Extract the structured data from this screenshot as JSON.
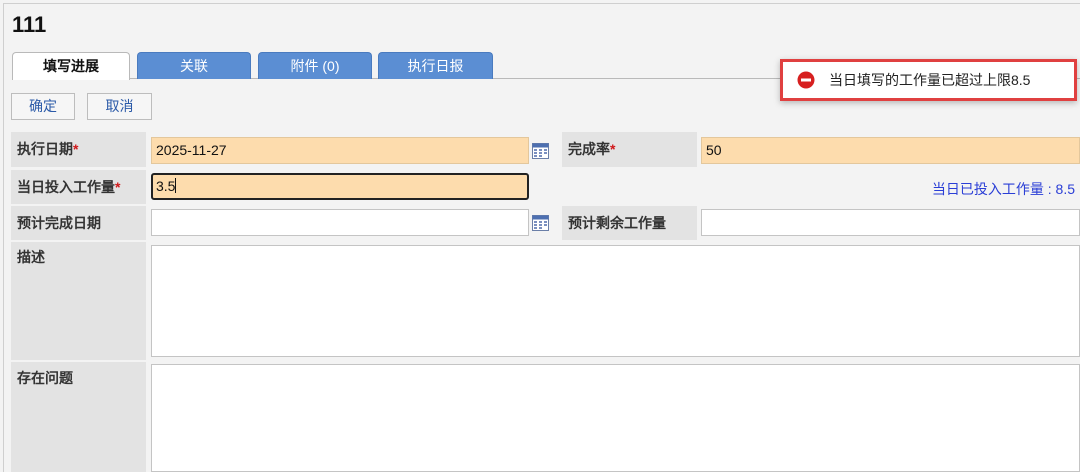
{
  "page": {
    "title": "111"
  },
  "tabs": [
    {
      "label": "填写进展",
      "active": true
    },
    {
      "label": "关联",
      "active": false
    },
    {
      "label": "附件 (0)",
      "active": false
    },
    {
      "label": "执行日报",
      "active": false
    }
  ],
  "toolbar": {
    "confirm_label": "确定",
    "cancel_label": "取消"
  },
  "form": {
    "exec_date": {
      "label": "执行日期",
      "value": "2025-11-27"
    },
    "completion_rate": {
      "label": "完成率",
      "value": "50"
    },
    "daily_workload": {
      "label": "当日投入工作量",
      "value": "3.5"
    },
    "daily_workload_info": "当日已投入工作量 : 8.5",
    "planned_finish_date": {
      "label": "预计完成日期",
      "value": ""
    },
    "remaining_workload": {
      "label": "预计剩余工作量",
      "value": ""
    },
    "description": {
      "label": "描述",
      "value": ""
    },
    "issues": {
      "label": "存在问题",
      "value": ""
    },
    "required_mark": "*"
  },
  "toast": {
    "message": "当日填写的工作量已超过上限8.5",
    "icon": "error-stop-icon",
    "border_color": "#e04040",
    "icon_color": "#d72020"
  },
  "colors": {
    "tab_inactive": "#5b8ed3",
    "required_field_bg": "#fddcad",
    "label_bg": "#e3e3e3",
    "info_text": "#2a3ed6",
    "required_mark": "#d0181a"
  }
}
